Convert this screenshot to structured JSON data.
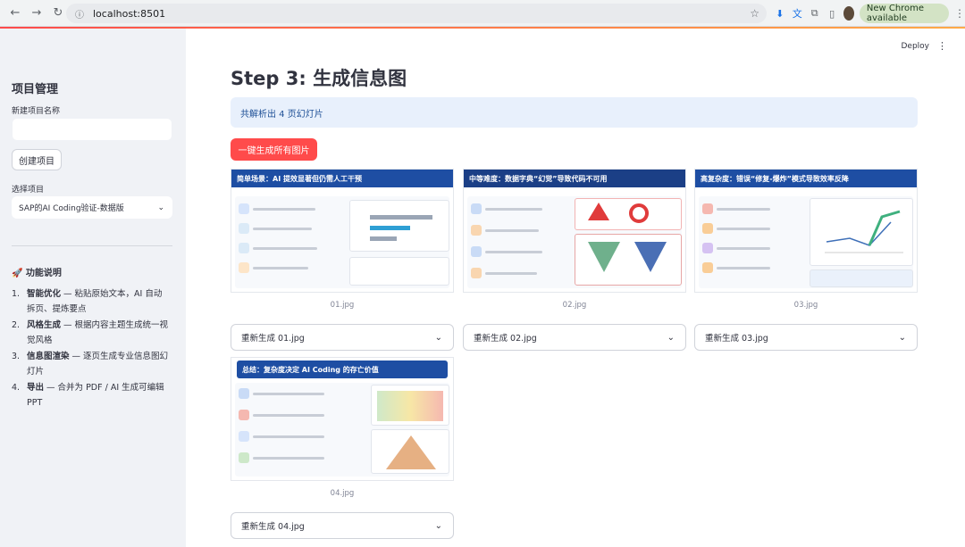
{
  "browser": {
    "url": "localhost:8501",
    "update_label": "New Chrome available"
  },
  "sidebar": {
    "title": "项目管理",
    "new_project_label": "新建项目名称",
    "new_project_value": "",
    "create_button": "创建项目",
    "select_label": "选择项目",
    "selected_project": "SAP的AI Coding验证-数据版",
    "features_title": "🚀 功能说明",
    "features": [
      {
        "num": "1.",
        "name": "智能优化",
        "desc": " — 粘贴原始文本，AI 自动拆页、提炼要点"
      },
      {
        "num": "2.",
        "name": "风格生成",
        "desc": " — 根据内容主题生成统一视觉风格"
      },
      {
        "num": "3.",
        "name": "信息图渲染",
        "desc": " — 逐页生成专业信息图幻灯片"
      },
      {
        "num": "4.",
        "name": "导出",
        "desc": " — 合并为 PDF / AI 生成可编辑 PPT"
      }
    ]
  },
  "main": {
    "deploy_label": "Deploy",
    "title": "Step 3: 生成信息图",
    "info": "共解析出 4 页幻灯片",
    "generate_all_button": "一键生成所有图片",
    "slides": [
      {
        "title": "简单场景：AI 提效显著但仍需人工干预",
        "caption": "01.jpg",
        "regen": "重新生成 01.jpg"
      },
      {
        "title": "中等难度：数据字典“幻觉”导致代码不可用",
        "caption": "02.jpg",
        "regen": "重新生成 02.jpg"
      },
      {
        "title": "高复杂度：错误“修复-爆炸”模式导致效率反降",
        "caption": "03.jpg",
        "regen": "重新生成 03.jpg"
      },
      {
        "title": "总结：复杂度决定 AI Coding 的存亡价值",
        "caption": "04.jpg",
        "regen": "重新生成 04.jpg"
      }
    ]
  },
  "colors": {
    "primary": "#ff4b4b",
    "slide_header": "#1e4ea3",
    "info_bg": "#e8f0fc",
    "sidebar_bg": "#f0f2f6"
  }
}
